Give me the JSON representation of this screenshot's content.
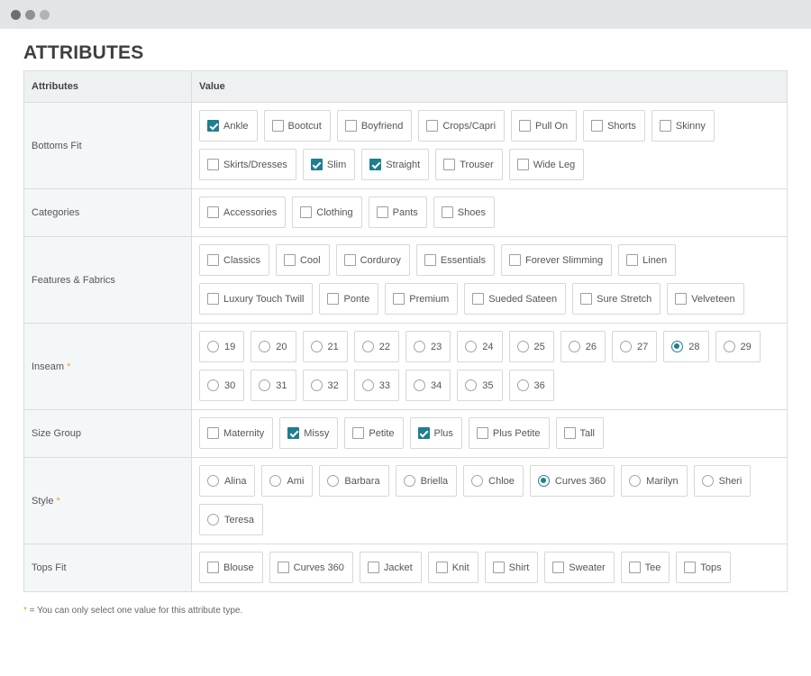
{
  "window": {
    "controls": [
      "close",
      "minimize",
      "maximize"
    ]
  },
  "page": {
    "title": "ATTRIBUTES"
  },
  "table": {
    "header_attribute": "Attributes",
    "header_value": "Value"
  },
  "footnote": {
    "marker": "*",
    "text": " = You can only select one value for this attribute type."
  },
  "colors": {
    "accent": "#1e7f8e",
    "required": "#f0a31c"
  },
  "rows": [
    {
      "label": "Bottoms Fit",
      "required": false,
      "input": "checkbox",
      "options": [
        {
          "label": "Ankle",
          "checked": true
        },
        {
          "label": "Bootcut",
          "checked": false
        },
        {
          "label": "Boyfriend",
          "checked": false
        },
        {
          "label": "Crops/Capri",
          "checked": false
        },
        {
          "label": "Pull On",
          "checked": false
        },
        {
          "label": "Shorts",
          "checked": false
        },
        {
          "label": "Skinny",
          "checked": false
        },
        {
          "label": "Skirts/Dresses",
          "checked": false
        },
        {
          "label": "Slim",
          "checked": true
        },
        {
          "label": "Straight",
          "checked": true
        },
        {
          "label": "Trouser",
          "checked": false
        },
        {
          "label": "Wide Leg",
          "checked": false
        }
      ]
    },
    {
      "label": "Categories",
      "required": false,
      "input": "checkbox",
      "options": [
        {
          "label": "Accessories",
          "checked": false
        },
        {
          "label": "Clothing",
          "checked": false
        },
        {
          "label": "Pants",
          "checked": false
        },
        {
          "label": "Shoes",
          "checked": false
        }
      ]
    },
    {
      "label": "Features & Fabrics",
      "required": false,
      "input": "checkbox",
      "options": [
        {
          "label": "Classics",
          "checked": false
        },
        {
          "label": "Cool",
          "checked": false
        },
        {
          "label": "Corduroy",
          "checked": false
        },
        {
          "label": "Essentials",
          "checked": false
        },
        {
          "label": "Forever Slimming",
          "checked": false
        },
        {
          "label": "Linen",
          "checked": false
        },
        {
          "label": "Luxury Touch Twill",
          "checked": false
        },
        {
          "label": "Ponte",
          "checked": false
        },
        {
          "label": "Premium",
          "checked": false
        },
        {
          "label": "Sueded Sateen",
          "checked": false
        },
        {
          "label": "Sure Stretch",
          "checked": false
        },
        {
          "label": "Velveteen",
          "checked": false
        }
      ]
    },
    {
      "label": "Inseam",
      "required": true,
      "input": "radio",
      "options": [
        {
          "label": "19",
          "checked": false
        },
        {
          "label": "20",
          "checked": false
        },
        {
          "label": "21",
          "checked": false
        },
        {
          "label": "22",
          "checked": false
        },
        {
          "label": "23",
          "checked": false
        },
        {
          "label": "24",
          "checked": false
        },
        {
          "label": "25",
          "checked": false
        },
        {
          "label": "26",
          "checked": false
        },
        {
          "label": "27",
          "checked": false
        },
        {
          "label": "28",
          "checked": true
        },
        {
          "label": "29",
          "checked": false
        },
        {
          "label": "30",
          "checked": false
        },
        {
          "label": "31",
          "checked": false
        },
        {
          "label": "32",
          "checked": false
        },
        {
          "label": "33",
          "checked": false
        },
        {
          "label": "34",
          "checked": false
        },
        {
          "label": "35",
          "checked": false
        },
        {
          "label": "36",
          "checked": false
        }
      ]
    },
    {
      "label": "Size Group",
      "required": false,
      "input": "checkbox",
      "options": [
        {
          "label": "Maternity",
          "checked": false
        },
        {
          "label": "Missy",
          "checked": true
        },
        {
          "label": "Petite",
          "checked": false
        },
        {
          "label": "Plus",
          "checked": true
        },
        {
          "label": "Plus Petite",
          "checked": false
        },
        {
          "label": "Tall",
          "checked": false
        }
      ]
    },
    {
      "label": "Style",
      "required": true,
      "input": "radio",
      "options": [
        {
          "label": "Alina",
          "checked": false
        },
        {
          "label": "Ami",
          "checked": false
        },
        {
          "label": "Barbara",
          "checked": false
        },
        {
          "label": "Briella",
          "checked": false
        },
        {
          "label": "Chloe",
          "checked": false
        },
        {
          "label": "Curves 360",
          "checked": true
        },
        {
          "label": "Marilyn",
          "checked": false
        },
        {
          "label": "Sheri",
          "checked": false
        },
        {
          "label": "Teresa",
          "checked": false
        }
      ]
    },
    {
      "label": "Tops Fit",
      "required": false,
      "input": "checkbox",
      "options": [
        {
          "label": "Blouse",
          "checked": false
        },
        {
          "label": "Curves 360",
          "checked": false
        },
        {
          "label": "Jacket",
          "checked": false
        },
        {
          "label": "Knit",
          "checked": false
        },
        {
          "label": "Shirt",
          "checked": false
        },
        {
          "label": "Sweater",
          "checked": false
        },
        {
          "label": "Tee",
          "checked": false
        },
        {
          "label": "Tops",
          "checked": false
        }
      ]
    }
  ]
}
